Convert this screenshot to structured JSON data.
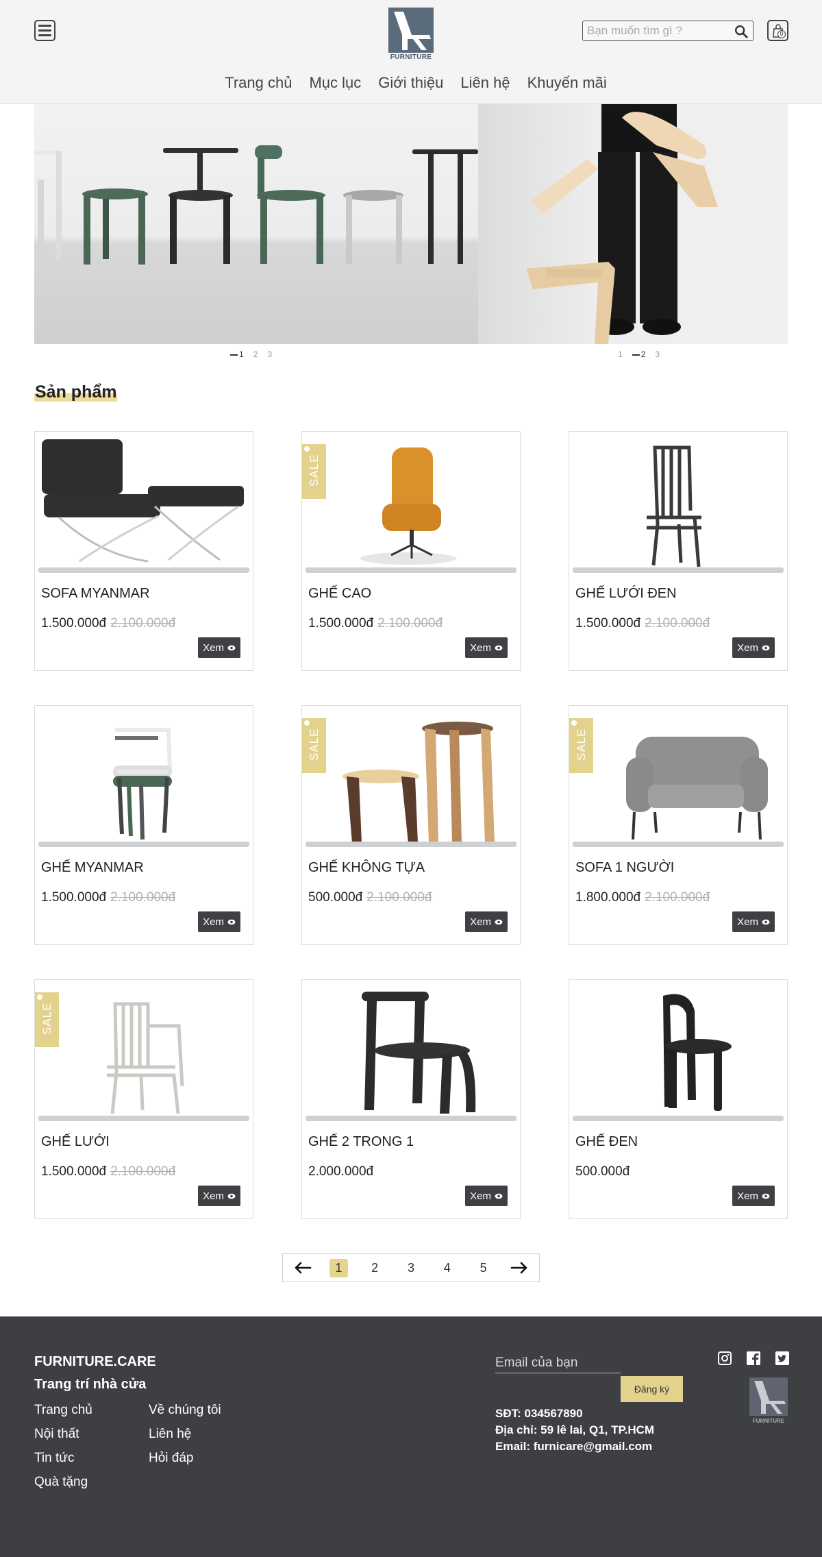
{
  "header": {
    "logo_text": "FURNITURE",
    "search_placeholder": "Bạn muốn tìm gì ?",
    "cart_count": "0",
    "nav": [
      "Trang chủ",
      "Mục lục",
      "Giới thiệu",
      "Liên hệ",
      "Khuyến mãi"
    ]
  },
  "banner": {
    "dots_left": [
      "1",
      "2",
      "3"
    ],
    "dots_right": [
      "1",
      "2",
      "3"
    ]
  },
  "section_title": "Sản phẩm",
  "sale_label": "SALE",
  "view_label": "Xem",
  "products": [
    {
      "name": "SOFA MYANMAR",
      "price": "1.500.000đ",
      "old_price": "2.100.000đ",
      "sale": false,
      "image": "barcelona-sofa-ottoman"
    },
    {
      "name": "GHẾ CAO",
      "price": "1.500.000đ",
      "old_price": "2.100.000đ",
      "sale": true,
      "image": "orange-office-chair"
    },
    {
      "name": "GHẾ LƯỚI ĐEN",
      "price": "1.500.000đ",
      "old_price": "2.100.000đ",
      "sale": false,
      "image": "black-slat-chair"
    },
    {
      "name": "GHẾ MYANMAR",
      "price": "1.500.000đ",
      "old_price": "2.100.000đ",
      "sale": false,
      "image": "stacked-chairs"
    },
    {
      "name": "GHẾ KHÔNG TỰA",
      "price": "500.000đ",
      "old_price": "2.100.000đ",
      "sale": true,
      "image": "wooden-stools"
    },
    {
      "name": "SOFA 1 NGƯỜI",
      "price": "1.800.000đ",
      "old_price": "2.100.000đ",
      "sale": true,
      "image": "grey-armchair"
    },
    {
      "name": "GHẾ LƯỚI",
      "price": "1.500.000đ",
      "old_price": "2.100.000đ",
      "sale": true,
      "image": "white-slat-armchair"
    },
    {
      "name": "GHẾ 2 TRONG 1",
      "price": "2.000.000đ",
      "old_price": "",
      "sale": false,
      "image": "black-step-stool"
    },
    {
      "name": "GHẾ ĐEN",
      "price": "500.000đ",
      "old_price": "",
      "sale": false,
      "image": "black-round-chair"
    }
  ],
  "pagination": {
    "pages": [
      "1",
      "2",
      "3",
      "4",
      "5"
    ],
    "active": "1"
  },
  "footer": {
    "brand": "FURNITURE.CARE",
    "tagline": "Trang trí nhà cửa",
    "links_col1": [
      "Trang chủ",
      "Nội thất",
      "Tin tức",
      "Quà tặng"
    ],
    "links_col2": [
      "Về chúng tôi",
      "Liên hệ",
      "Hỏi đáp"
    ],
    "email_placeholder": "Email của bạn",
    "subscribe_label": "Đăng ký",
    "phone": "SĐT: 034567890",
    "address": "Địa chỉ: 59 lê lai, Q1, TP.HCM",
    "email": "Email: furnicare@gmail.com",
    "social_icons": [
      "instagram-icon",
      "facebook-icon",
      "twitter-icon"
    ],
    "logo_text": "FURNITURE"
  },
  "colors": {
    "accent": "#e2d28c",
    "footer_bg": "#3e3f43",
    "button_dark": "#3f4044",
    "logo_blue": "#5a6b7c"
  }
}
